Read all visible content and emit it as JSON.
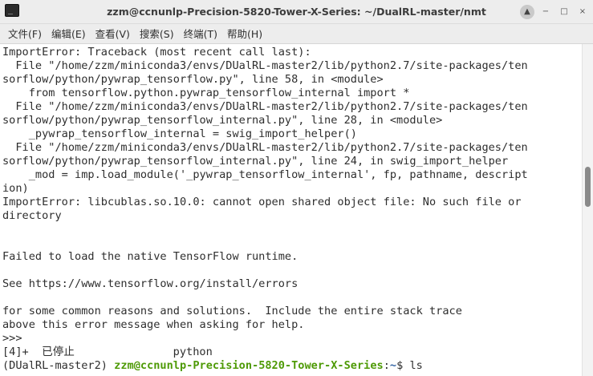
{
  "window": {
    "title": "zzm@ccnunlp-Precision-5820-Tower-X-Series: ~/DualRL-master/nmt",
    "icon": "terminal-icon",
    "icon_glyph": "_",
    "controls": {
      "up": "▲",
      "minimize": "−",
      "maximize": "□",
      "close": "×"
    }
  },
  "menubar": {
    "items": [
      {
        "label": "文件(F)"
      },
      {
        "label": "编辑(E)"
      },
      {
        "label": "查看(V)"
      },
      {
        "label": "搜索(S)"
      },
      {
        "label": "终端(T)"
      },
      {
        "label": "帮助(H)"
      }
    ]
  },
  "terminal": {
    "lines": [
      "ImportError: Traceback (most recent call last):",
      "  File \"/home/zzm/miniconda3/envs/DUalRL-master2/lib/python2.7/site-packages/ten",
      "sorflow/python/pywrap_tensorflow.py\", line 58, in <module>",
      "    from tensorflow.python.pywrap_tensorflow_internal import *",
      "  File \"/home/zzm/miniconda3/envs/DUalRL-master2/lib/python2.7/site-packages/ten",
      "sorflow/python/pywrap_tensorflow_internal.py\", line 28, in <module>",
      "    _pywrap_tensorflow_internal = swig_import_helper()",
      "  File \"/home/zzm/miniconda3/envs/DUalRL-master2/lib/python2.7/site-packages/ten",
      "sorflow/python/pywrap_tensorflow_internal.py\", line 24, in swig_import_helper",
      "    _mod = imp.load_module('_pywrap_tensorflow_internal', fp, pathname, descript",
      "ion)",
      "ImportError: libcublas.so.10.0: cannot open shared object file: No such file or",
      "directory",
      "",
      "",
      "Failed to load the native TensorFlow runtime.",
      "",
      "See https://www.tensorflow.org/install/errors",
      "",
      "for some common reasons and solutions.  Include the entire stack trace",
      "above this error message when asking for help.",
      ">>>",
      "[4]+  已停止               python"
    ],
    "prompt": {
      "env": "(DUalRL-master2) ",
      "user_host": "zzm@ccnunlp-Precision-5820-Tower-X-Series",
      "separator": ":",
      "path": "~",
      "symbol": "$ ",
      "command": "ls"
    },
    "scroll": {
      "position": 0.42,
      "visible_fraction": 0.12
    }
  },
  "colors": {
    "prompt_user": "#4e9a06",
    "prompt_path": "#3465a4",
    "text": "#2e2e2e",
    "background": "#ffffff"
  }
}
